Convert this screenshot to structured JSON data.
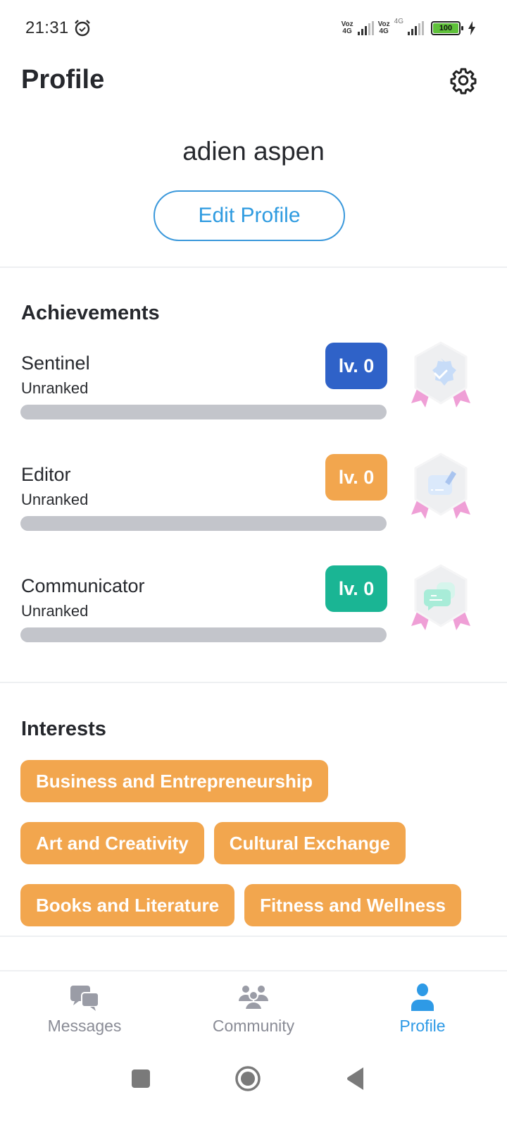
{
  "status_bar": {
    "time": "21:31",
    "sim1_label_top": "Voz",
    "sim1_label_bottom": "4G",
    "sim2_label_top": "Voz",
    "sim2_label_bottom": "4G",
    "data_label": "4G",
    "battery_percent": "100"
  },
  "header": {
    "title": "Profile"
  },
  "profile": {
    "name": "adien aspen",
    "edit_label": "Edit Profile"
  },
  "achievements": {
    "title": "Achievements",
    "items": [
      {
        "name": "Sentinel",
        "rank": "Unranked",
        "level": "lv. 0",
        "progress": 0,
        "color": "#2f62c8",
        "badge": "shield-check"
      },
      {
        "name": "Editor",
        "rank": "Unranked",
        "level": "lv. 0",
        "progress": 0,
        "color": "#f2a64e",
        "badge": "pencil-doc"
      },
      {
        "name": "Communicator",
        "rank": "Unranked",
        "level": "lv. 0",
        "progress": 0,
        "color": "#1ab594",
        "badge": "chat-bubble"
      }
    ]
  },
  "interests": {
    "title": "Interests",
    "chip_color": "#f2a64e",
    "items": [
      "Business and Entrepreneurship",
      "Art and Creativity",
      "Cultural Exchange",
      "Books and Literature",
      "Fitness and Wellness"
    ]
  },
  "bottom_nav": {
    "items": [
      {
        "label": "Messages",
        "icon": "messages-icon",
        "active": false
      },
      {
        "label": "Community",
        "icon": "community-icon",
        "active": false
      },
      {
        "label": "Profile",
        "icon": "profile-icon",
        "active": true
      }
    ],
    "active_color": "#2e9ae6",
    "inactive_color": "#9a9ca6"
  }
}
